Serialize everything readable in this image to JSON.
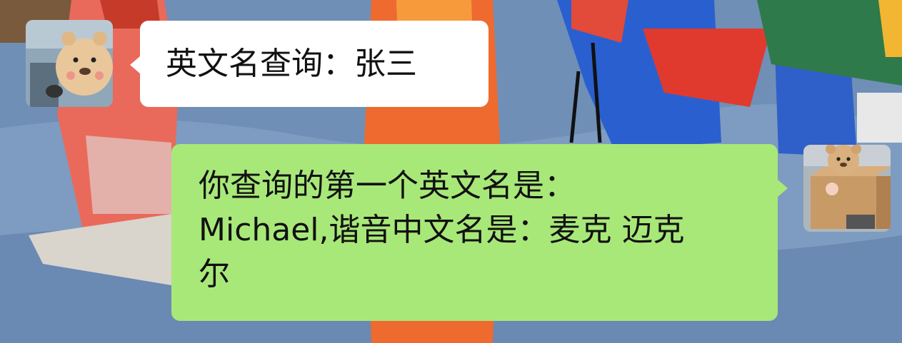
{
  "messages": [
    {
      "side": "left",
      "sender": "user",
      "avatar_icon": "bear-avatar-icon",
      "text": "英文名查询：张三"
    },
    {
      "side": "right",
      "sender": "bot",
      "avatar_icon": "bear-in-box-avatar-icon",
      "text": "你查询的第一个英文名是：\nMichael,谐音中文名是：麦克 迈克\n尔"
    }
  ],
  "colors": {
    "incoming_bubble": "#ffffff",
    "outgoing_bubble": "#a8e879",
    "background_accent": "#6f8fb6"
  }
}
